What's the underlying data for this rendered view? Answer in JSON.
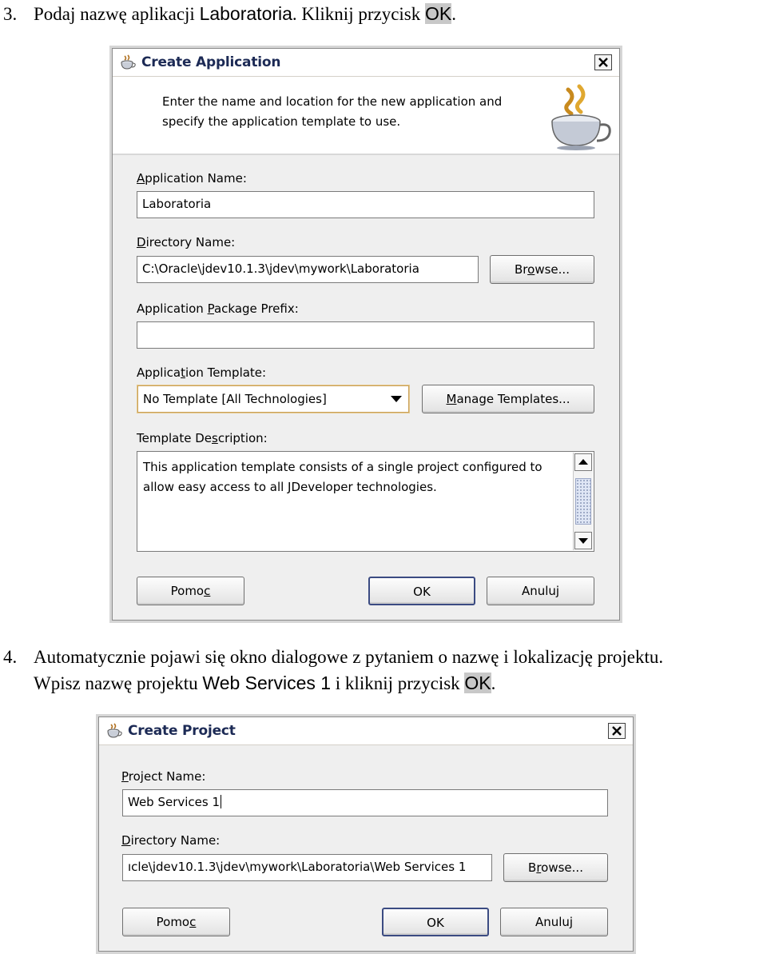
{
  "step3": {
    "number": "3.",
    "text_before": "Podaj nazwę aplikacji ",
    "app_name": "Laboratoria",
    "text_middle": ". Kliknij przycisk ",
    "ok": "OK",
    "text_after": "."
  },
  "step4": {
    "number": "4.",
    "line1": "Automatycznie pojawi się okno dialogowe z pytaniem o nazwę i lokalizację projektu.",
    "line2_before": "Wpisz nazwę projektu ",
    "project_name": "Web Services 1",
    "line2_middle": " i kliknij przycisk ",
    "ok": "OK",
    "line2_after": "."
  },
  "create_application": {
    "title": "Create Application",
    "header_line1": "Enter the name and location for the new application and",
    "header_line2": "specify the application template to use.",
    "app_name_label_u": "A",
    "app_name_label_rest": "pplication Name:",
    "app_name_value": "Laboratoria",
    "dir_label_u": "D",
    "dir_label_rest": "irectory Name:",
    "dir_value": "C:\\Oracle\\jdev10.1.3\\jdev\\mywork\\Laboratoria",
    "browse_pre": "Br",
    "browse_u": "o",
    "browse_post": "wse...",
    "prefix_label_pre": "Application ",
    "prefix_label_u": "P",
    "prefix_label_post": "ackage Prefix:",
    "prefix_value": "",
    "template_label_pre": "Applica",
    "template_label_u": "t",
    "template_label_post": "ion Template:",
    "template_value": "No Template [All Technologies]",
    "manage_u": "M",
    "manage_rest": "anage Templates...",
    "desc_label_pre": "Template De",
    "desc_label_u": "s",
    "desc_label_post": "cription:",
    "desc_line1": "This application template consists of a single project configured to",
    "desc_line2": "allow easy access to all JDeveloper technologies.",
    "help_pre": "Pomo",
    "help_u": "c",
    "ok": "OK",
    "cancel": "Anuluj"
  },
  "create_project": {
    "title": "Create Project",
    "name_label_u": "P",
    "name_label_rest": "roject Name:",
    "name_value": "Web Services 1",
    "dir_label_u": "D",
    "dir_label_rest": "irectory Name:",
    "dir_value": "ıcle\\jdev10.1.3\\jdev\\mywork\\Laboratoria\\Web Services 1",
    "browse_pre": "B",
    "browse_u": "r",
    "browse_post": "owse...",
    "help_pre": "Pomo",
    "help_u": "c",
    "ok": "OK",
    "cancel": "Anuluj"
  }
}
